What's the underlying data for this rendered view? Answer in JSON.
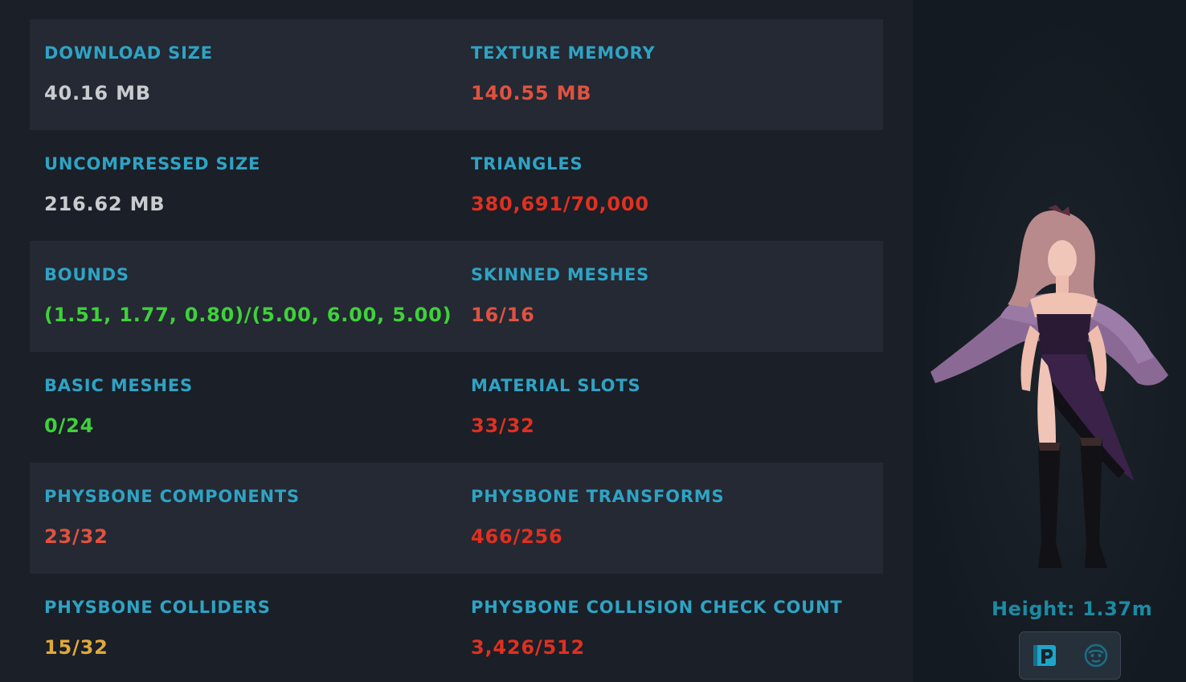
{
  "colors": {
    "label": "#2fa3c4",
    "value_neutral": "#c9cccf",
    "value_good": "#3fd13a",
    "value_warn": "#e0a93a",
    "value_bad": "#e05240",
    "value_very_bad": "#e0301f",
    "height_text": "#1c8aa3"
  },
  "stats": [
    {
      "left": {
        "label": "DOWNLOAD SIZE",
        "value": "40.16 MB",
        "status": "neutral"
      },
      "right": {
        "label": "TEXTURE MEMORY",
        "value": "140.55 MB",
        "status": "bad"
      }
    },
    {
      "left": {
        "label": "UNCOMPRESSED SIZE",
        "value": "216.62 MB",
        "status": "neutral"
      },
      "right": {
        "label": "TRIANGLES",
        "value": "380,691/70,000",
        "status": "very_bad"
      }
    },
    {
      "left": {
        "label": "BOUNDS",
        "value": "(1.51, 1.77, 0.80)/(5.00, 6.00, 5.00)",
        "status": "good"
      },
      "right": {
        "label": "SKINNED MESHES",
        "value": "16/16",
        "status": "bad"
      }
    },
    {
      "left": {
        "label": "BASIC MESHES",
        "value": "0/24",
        "status": "good"
      },
      "right": {
        "label": "MATERIAL SLOTS",
        "value": "33/32",
        "status": "very_bad"
      }
    },
    {
      "left": {
        "label": "PHYSBONE COMPONENTS",
        "value": "23/32",
        "status": "bad"
      },
      "right": {
        "label": "PHYSBONE TRANSFORMS",
        "value": "466/256",
        "status": "very_bad"
      }
    },
    {
      "left": {
        "label": "PHYSBONE COLLIDERS",
        "value": "15/32",
        "status": "warn"
      },
      "right": {
        "label": "PHYSBONE COLLISION CHECK COUNT",
        "value": "3,426/512",
        "status": "very_bad"
      }
    }
  ],
  "preview": {
    "height_text": "Height: 1.37m",
    "toolbar_icons": [
      "avatar-details-icon",
      "face-icon"
    ]
  }
}
